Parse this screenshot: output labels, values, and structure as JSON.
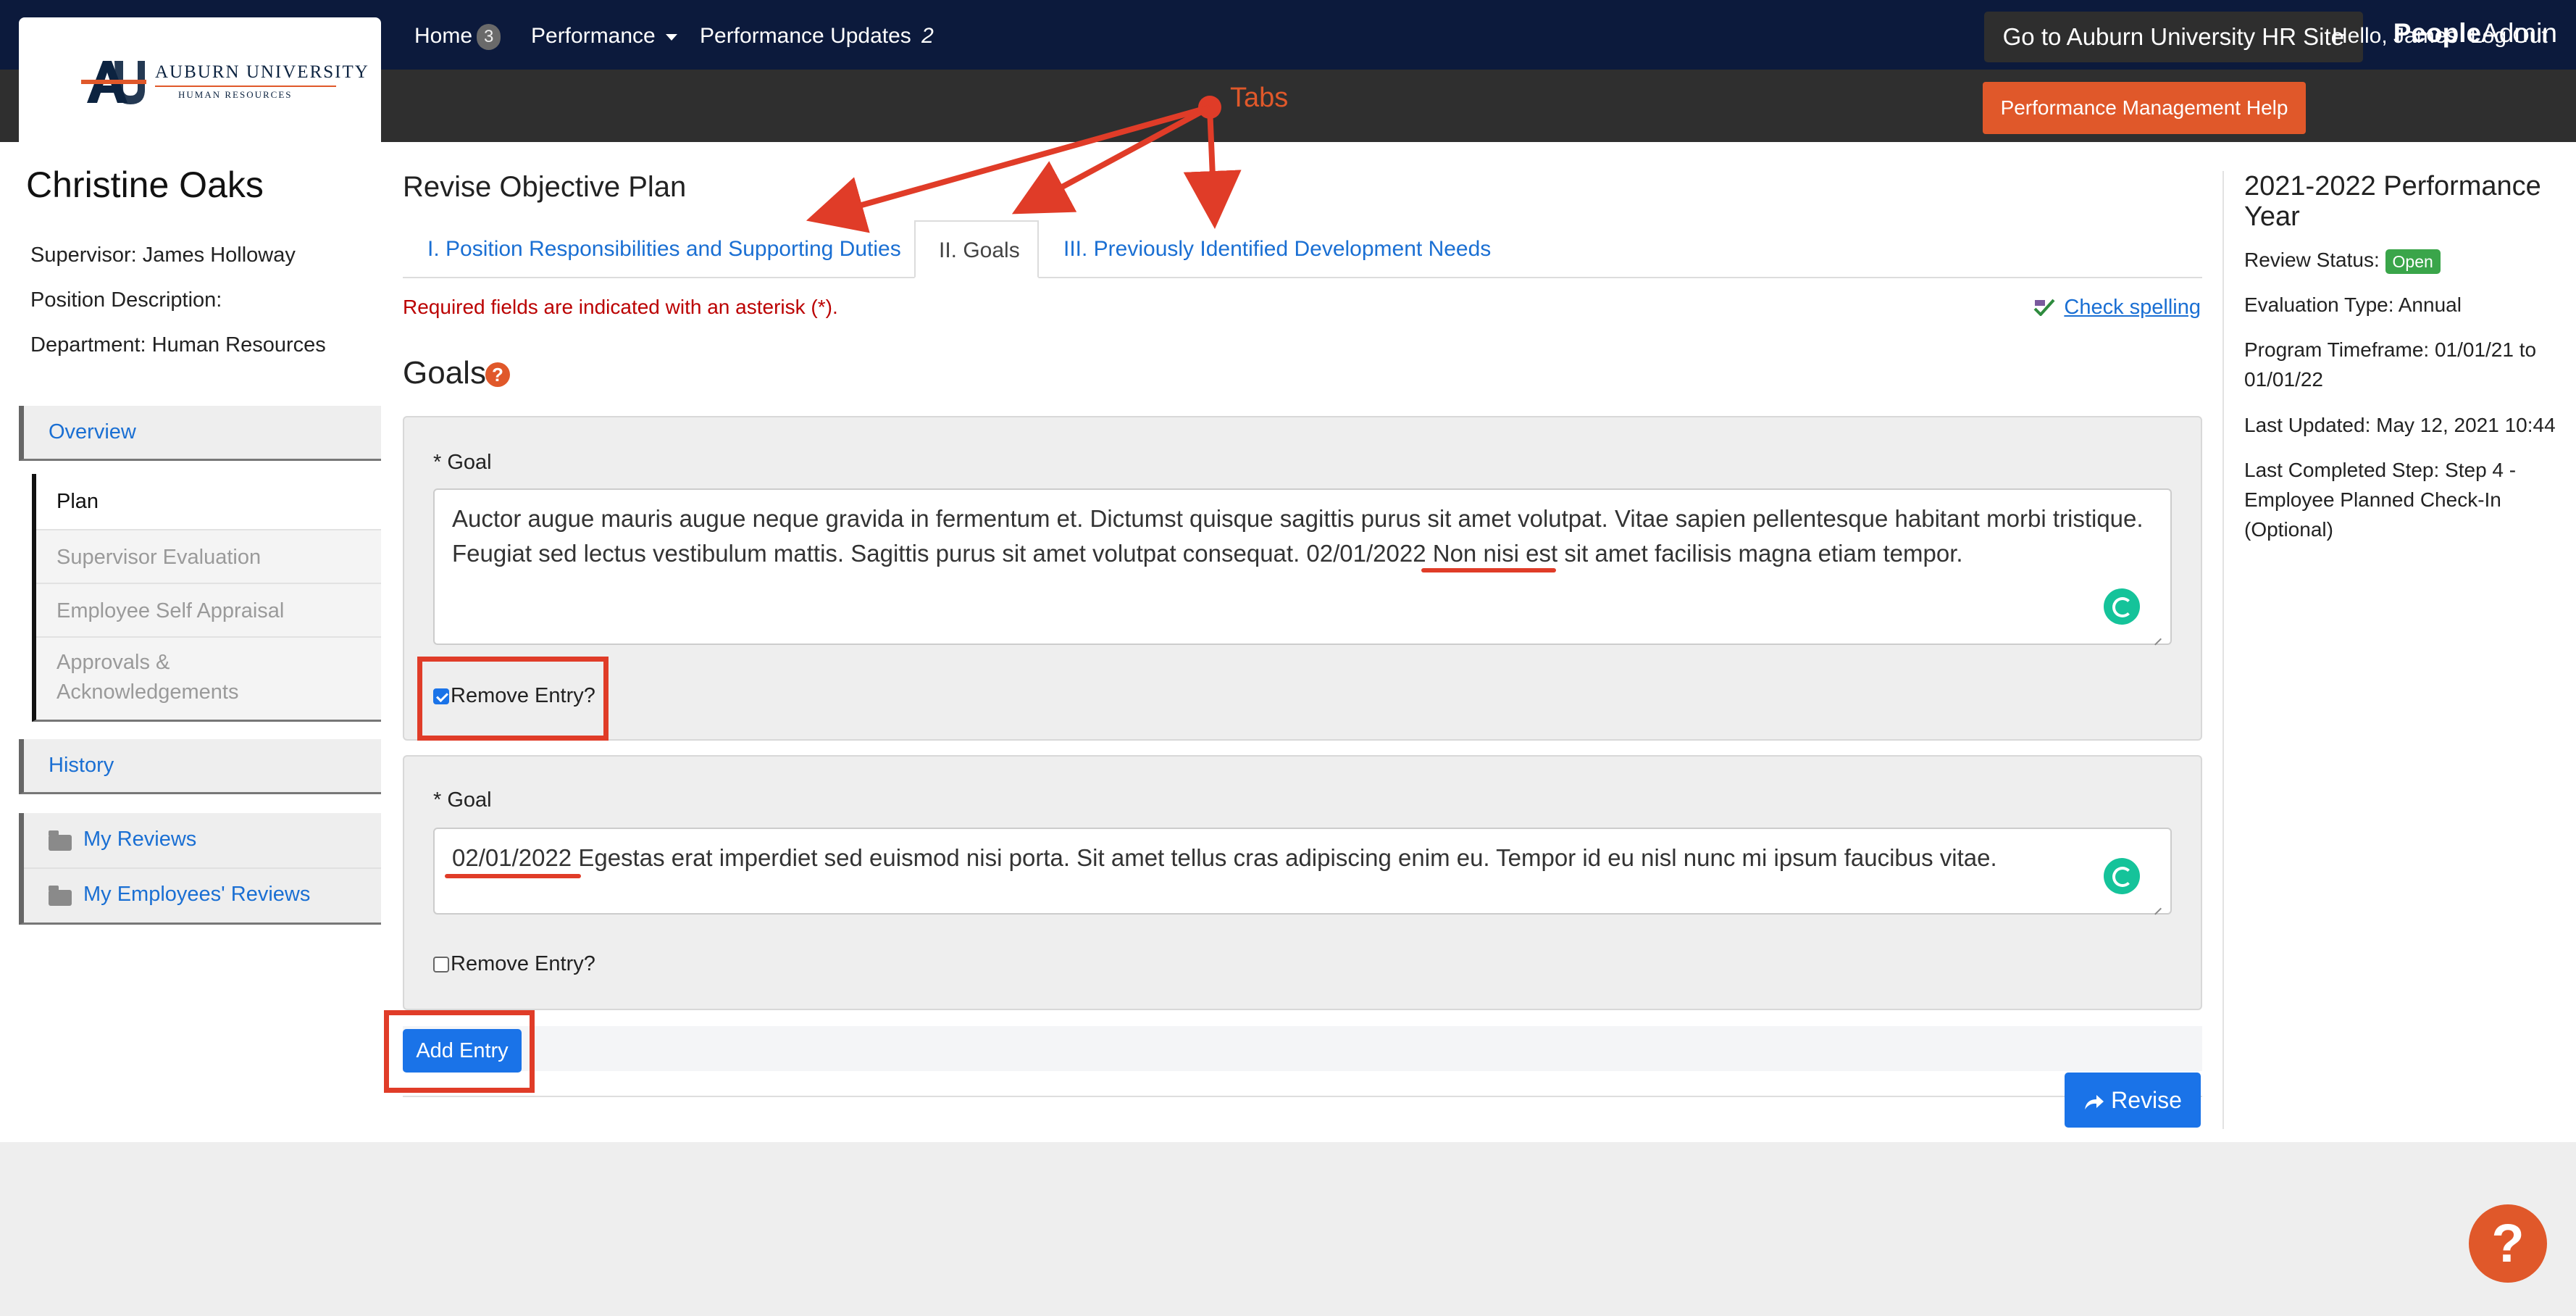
{
  "header": {
    "hr_site_button": "Go to Auburn University HR Site",
    "brand_bold": "People",
    "brand_rest": "Admin",
    "logo_line1": "AUBURN UNIVERSITY",
    "logo_line2": "HUMAN RESOURCES"
  },
  "nav": {
    "home": "Home",
    "home_count": "3",
    "performance": "Performance",
    "updates": "Performance Updates",
    "updates_count": "2",
    "help_button": "Performance Management Help",
    "greeting": "Hello, James",
    "logout": "Log Out"
  },
  "employee": {
    "name": "Christine Oaks",
    "supervisor": "Supervisor: James Holloway",
    "position": "Position Description:",
    "department": "Department: Human Resources"
  },
  "sidebar": {
    "overview": "Overview",
    "plan": "Plan",
    "supervisor_eval": "Supervisor Evaluation",
    "self_appraisal": "Employee Self Appraisal",
    "approvals_1": "Approvals &",
    "approvals_2": "Acknowledgements",
    "history": "History",
    "my_reviews": "My Reviews",
    "emp_reviews": "My Employees' Reviews"
  },
  "main": {
    "title": "Revise Objective Plan",
    "tabs": [
      {
        "label": "I. Position Responsibilities and Supporting Duties"
      },
      {
        "label": "II. Goals"
      },
      {
        "label": "III. Previously Identified Development Needs"
      }
    ],
    "required_note": "Required fields are indicated with an asterisk (*).",
    "check_spelling": "Check spelling",
    "section_title": "Goals",
    "goals": [
      {
        "label": "* Goal",
        "text": "Auctor augue mauris augue neque gravida in fermentum et. Dictumst quisque sagittis purus sit amet volutpat. Vitae sapien pellentesque habitant morbi tristique. Feugiat sed lectus vestibulum mattis. Sagittis purus sit amet volutpat consequat. 02/01/2022 Non nisi est sit amet facilisis magna etiam tempor.",
        "remove_label": "Remove Entry?",
        "remove_checked": true
      },
      {
        "label": "* Goal",
        "text": "02/01/2022 Egestas erat imperdiet sed euismod nisi porta. Sit amet tellus cras adipiscing enim eu. Tempor id eu nisl nunc mi ipsum faucibus vitae.",
        "remove_label": "Remove Entry?",
        "remove_checked": false
      }
    ],
    "add_entry": "Add Entry",
    "revise": "Revise"
  },
  "review": {
    "year": "2021-2022 Performance Year",
    "status_label": "Review Status:",
    "status_value": "Open",
    "eval_type": "Evaluation Type: Annual",
    "timeframe": "Program Timeframe: 01/01/21 to 01/01/22",
    "last_updated": "Last Updated: May 12, 2021 10:44",
    "last_step": "Last Completed Step: Step 4 - Employee Planned Check-In (Optional)"
  },
  "annotation": {
    "tabs_label": "Tabs"
  },
  "colors": {
    "navy": "#0c1a3c",
    "orange": "#e0582a",
    "link_blue": "#1a6fd3",
    "button_blue": "#1a73e8",
    "annotation_red": "#e03c28",
    "open_green": "#3aa54a"
  }
}
